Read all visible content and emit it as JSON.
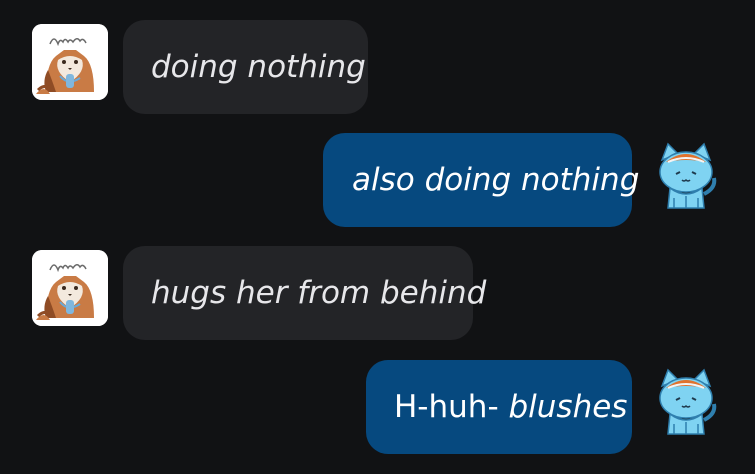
{
  "messages": [
    {
      "side": "left",
      "avatar_icon": "red-panda-sticker-avatar-icon",
      "avatar_signature": "Angie",
      "parts": [
        {
          "text": "doing nothing",
          "italic": true
        }
      ]
    },
    {
      "side": "right",
      "avatar_icon": "blue-cat-sticker-avatar-icon",
      "parts": [
        {
          "text": "also doing nothing",
          "italic": true
        }
      ]
    },
    {
      "side": "left",
      "avatar_icon": "red-panda-sticker-avatar-icon",
      "avatar_signature": "Angie",
      "parts": [
        {
          "text": "hugs her from behind",
          "italic": true
        }
      ]
    },
    {
      "side": "right",
      "avatar_icon": "blue-cat-sticker-avatar-icon",
      "parts": [
        {
          "text": "H-huh- ",
          "italic": false
        },
        {
          "text": "blushes",
          "italic": true
        }
      ]
    }
  ],
  "colors": {
    "background": "#111214",
    "bubble_incoming": "#232427",
    "bubble_outgoing": "#06497f",
    "text_incoming": "#e7e7ea",
    "text_outgoing": "#ffffff"
  }
}
